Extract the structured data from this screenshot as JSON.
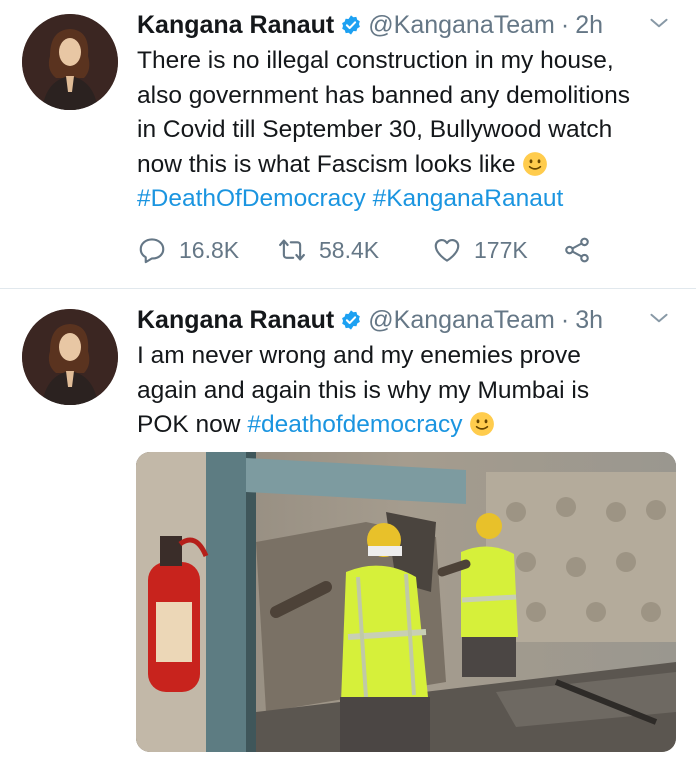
{
  "tweets": [
    {
      "author": {
        "name": "Kangana Ranaut",
        "handle": "@KanganaTeam",
        "verified": true
      },
      "time": "2h",
      "text_lines": [
        "There is no illegal construction in my house,",
        "also government has banned any demolitions",
        "in Covid till September 30, Bullywood watch",
        "now this is what Fascism looks like"
      ],
      "hashtags": [
        "#DeathOfDemocracy",
        "#KanganaRanaut"
      ],
      "stats": {
        "replies": "16.8K",
        "retweets": "58.4K",
        "likes": "177K"
      }
    },
    {
      "author": {
        "name": "Kangana Ranaut",
        "handle": "@KanganaTeam",
        "verified": true
      },
      "time": "3h",
      "text_lines": [
        "I am never wrong and my enemies prove",
        "again and again this is why my Mumbai is",
        "POK now"
      ],
      "hashtags": [
        "#deathofdemocracy"
      ],
      "media": {
        "type": "photo"
      }
    }
  ],
  "icons": {
    "verified": "verified-badge-icon",
    "more": "chevron-down-icon",
    "reply": "reply-icon",
    "retweet": "retweet-icon",
    "like": "heart-icon",
    "share": "share-icon",
    "emoji": "slightly-smiling-face-emoji"
  },
  "colors": {
    "link": "#1b95e0",
    "verified": "#1da1f2",
    "muted": "#657786",
    "text": "#14171a"
  }
}
